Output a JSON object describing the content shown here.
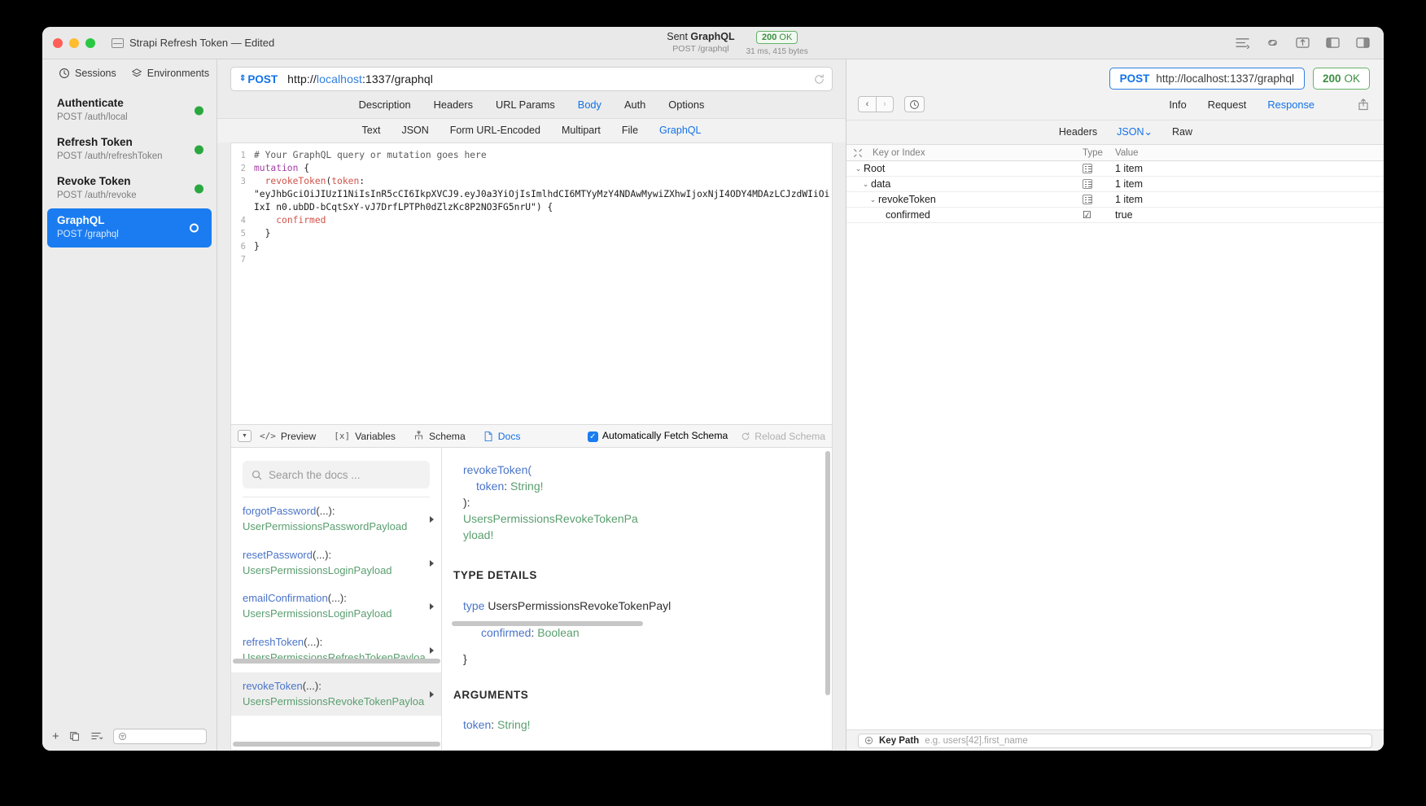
{
  "window": {
    "title": "Strapi Refresh Token — Edited",
    "traffic_lights": [
      "close",
      "minimize",
      "zoom"
    ]
  },
  "titlebar": {
    "sent_prefix": "Sent ",
    "sent_name": "GraphQL",
    "sent_sub": "POST /graphql",
    "status_code": "200",
    "status_text": "OK",
    "status_meta": "31 ms, 415 bytes",
    "icons": [
      "list-icon",
      "link-icon",
      "export-icon",
      "left-panel-icon",
      "right-panel-icon"
    ]
  },
  "sidebar": {
    "tabs": [
      {
        "label": "Sessions",
        "icon": "clock-icon",
        "active": true
      },
      {
        "label": "Environments",
        "icon": "layers-icon",
        "active": false
      }
    ],
    "sessions": [
      {
        "name": "Authenticate",
        "sub": "POST /auth/local",
        "active": false,
        "status": "green"
      },
      {
        "name": "Refresh Token",
        "sub": "POST /auth/refreshToken",
        "active": false,
        "status": "green"
      },
      {
        "name": "Revoke Token",
        "sub": "POST /auth/revoke",
        "active": false,
        "status": "green"
      },
      {
        "name": "GraphQL",
        "sub": "POST /graphql",
        "active": true,
        "status": "green"
      }
    ],
    "footer_icons": [
      "add-icon",
      "duplicate-icon",
      "sort-icon",
      "filter-icon"
    ]
  },
  "request": {
    "method": "POST",
    "url_prefix": "http://",
    "url_host": "localhost",
    "url_suffix": ":1337/graphql",
    "reload_icon": "reload-icon",
    "tabs": [
      {
        "label": "Description",
        "active": false
      },
      {
        "label": "Headers",
        "active": false
      },
      {
        "label": "URL Params",
        "active": false
      },
      {
        "label": "Body",
        "active": true
      },
      {
        "label": "Auth",
        "active": false
      },
      {
        "label": "Options",
        "active": false
      }
    ],
    "format_tabs": [
      {
        "label": "Text",
        "active": false
      },
      {
        "label": "JSON",
        "active": false
      },
      {
        "label": "Form URL-Encoded",
        "active": false
      },
      {
        "label": "Multipart",
        "active": false
      },
      {
        "label": "File",
        "active": false
      },
      {
        "label": "GraphQL",
        "active": true
      }
    ],
    "editor": {
      "line_numbers": [
        "1",
        "2",
        "3",
        "4",
        "5",
        "6",
        "7"
      ],
      "comment": "# Your GraphQL query or mutation goes here",
      "keyword": "mutation",
      "open_brace": " {",
      "field_name": "revokeToken",
      "arg_name": "token",
      "token_value": "\"eyJhbGciOiJIUzI1NiIsInR5cCI6IkpXVCJ9.eyJ0a3YiOjIsImlhdCI6MTYyMzY4NDAwMywiZXhwIjoxNjI4ODY4MDAzLCJzdWIiOiIxI n0.ubDD-bCqtSxY-vJ7DrfLPTPh0dZlzKc8P2NO3FG5nrU\") {",
      "selection": "confirmed",
      "close_inner": "  }",
      "close_outer": "}"
    }
  },
  "toolbar": {
    "disclosure_icon": "chevron-down-icon",
    "items": [
      {
        "label": "Preview",
        "glyph": "</>",
        "active": false
      },
      {
        "label": "Variables",
        "glyph": "[x]",
        "active": false
      },
      {
        "label": "Schema",
        "glyph": "schema-icon",
        "active": false
      },
      {
        "label": "Docs",
        "glyph": "doc-icon",
        "active": true
      }
    ],
    "auto_fetch_label": "Automatically Fetch Schema",
    "auto_fetch_checked": true,
    "reload_schema_label": "Reload Schema"
  },
  "docs": {
    "search_placeholder": "Search the docs ...",
    "search_icon": "search-icon",
    "entries": [
      {
        "name": "forgotPassword",
        "args": "(...):",
        "type": "UserPermissionsPasswordPayload",
        "selected": false
      },
      {
        "name": "resetPassword",
        "args": "(...):",
        "type": "UsersPermissionsLoginPayload",
        "selected": false
      },
      {
        "name": "emailConfirmation",
        "args": "(...):",
        "type": "UsersPermissionsLoginPayload",
        "selected": false
      },
      {
        "name": "refreshToken",
        "args": "(...):",
        "type": "UsersPermissionsRefreshTokenPayloa",
        "selected": false
      },
      {
        "name": "revokeToken",
        "args": "(...):",
        "type": "UsersPermissionsRevokeTokenPayloa",
        "selected": true
      }
    ],
    "detail": {
      "sig_name": "revokeToken(",
      "sig_param": "token",
      "sig_param_type": "String!",
      "sig_close": "):",
      "sig_return_1": "UsersPermissionsRevokeTokenPa",
      "sig_return_2": "yload!",
      "type_details_heading": "TYPE DETAILS",
      "type_keyword": "type",
      "type_name": "UsersPermissionsRevokeTokenPayl",
      "field_name": "confirmed",
      "field_type": "Boolean",
      "closing_brace": "}",
      "arguments_heading": "ARGUMENTS",
      "arg_name": "token",
      "arg_type": "String!"
    }
  },
  "response": {
    "method": "POST",
    "url": "http://localhost:1337/graphql",
    "status_code": "200",
    "status_text": "OK",
    "nav": {
      "back_icon": "chevron-left-icon",
      "forward_icon": "chevron-right-icon",
      "history_icon": "clock-icon",
      "share_icon": "share-icon"
    },
    "tabs": [
      {
        "label": "Info",
        "active": false
      },
      {
        "label": "Request",
        "active": false
      },
      {
        "label": "Response",
        "active": true
      }
    ],
    "format_tabs": [
      {
        "label": "Headers",
        "active": false
      },
      {
        "label": "JSON",
        "active": true,
        "chevron": "⌄"
      },
      {
        "label": "Raw",
        "active": false
      }
    ],
    "tree_headers": {
      "expand_icon": "collapse-icon",
      "key": "Key or Index",
      "type": "Type",
      "value": "Value"
    },
    "tree_rows": [
      {
        "indent": 0,
        "caret": "⌄",
        "key": "Root",
        "type": "object",
        "value": "1 item"
      },
      {
        "indent": 1,
        "caret": "⌄",
        "key": "data",
        "type": "object",
        "value": "1 item"
      },
      {
        "indent": 2,
        "caret": "⌄",
        "key": "revokeToken",
        "type": "object",
        "value": "1 item"
      },
      {
        "indent": 3,
        "caret": "",
        "key": "confirmed",
        "type": "boolean",
        "value": "true"
      }
    ],
    "keypath": {
      "icon": "keypath-icon",
      "label": "Key Path",
      "placeholder": "e.g. users[42].first_name"
    }
  }
}
